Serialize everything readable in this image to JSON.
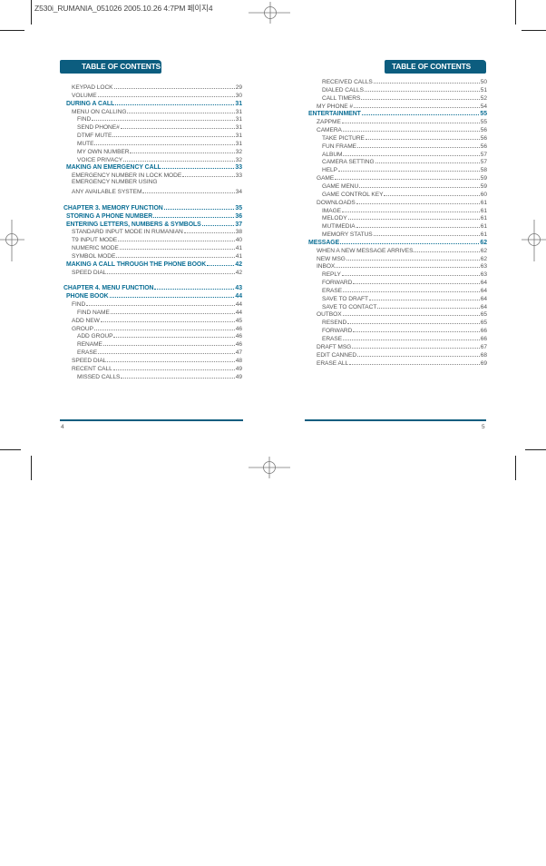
{
  "slug": "Z530i_RUMANIA_051026  2005.10.26 4:7PM 페이지4",
  "header_title": "TABLE OF CONTENTS",
  "left_page": {
    "folio": "4",
    "entries": [
      {
        "text": "KEYPAD LOCK",
        "page": "29",
        "style": "sub",
        "indent": 2
      },
      {
        "text": "VOLUME",
        "page": "30",
        "style": "sub",
        "indent": 2
      },
      {
        "text": "DURING A CALL",
        "page": "31",
        "style": "section",
        "indent": 1
      },
      {
        "text": "MENU ON CALLING",
        "page": "31",
        "style": "sub",
        "indent": 2
      },
      {
        "text": "FIND",
        "page": "31",
        "style": "sub",
        "indent": 3
      },
      {
        "text": "SEND PHONE#",
        "page": "31",
        "style": "sub",
        "indent": 3
      },
      {
        "text": "DTMF MUTE",
        "page": "31",
        "style": "sub",
        "indent": 3
      },
      {
        "text": "MUTE",
        "page": "31",
        "style": "sub",
        "indent": 3
      },
      {
        "text": "MY OWN NUMBER",
        "page": "32",
        "style": "sub",
        "indent": 3
      },
      {
        "text": "VOICE PRIVACY",
        "page": "32",
        "style": "sub",
        "indent": 3
      },
      {
        "text": "MAKING AN EMERGENCY CALL",
        "page": "33",
        "style": "section",
        "indent": 1
      },
      {
        "text": "EMERGENCY NUMBER IN LOCK MODE",
        "page": "33",
        "style": "sub",
        "indent": 2
      },
      {
        "text": "EMERGENCY NUMBER USING",
        "page": "",
        "style": "sub",
        "indent": 2
      },
      {
        "text": "ANY AVAILABLE SYSTEM",
        "page": "34",
        "style": "sub",
        "indent": 2
      },
      {
        "text": "",
        "page": "",
        "style": "gap",
        "indent": 0
      },
      {
        "text": "CHAPTER 3. MEMORY FUNCTION",
        "page": "35",
        "style": "chapter",
        "indent": 0
      },
      {
        "text": "STORING A PHONE NUMBER",
        "page": "36",
        "style": "section",
        "indent": 1
      },
      {
        "text": "ENTERING LETTERS, NUMBERS & SYMBOLS",
        "page": "37",
        "style": "section",
        "indent": 1
      },
      {
        "text": "STANDARD INPUT MODE IN RUMANIAN",
        "page": "38",
        "style": "sub",
        "indent": 2
      },
      {
        "text": "T9 INPUT MODE",
        "page": "40",
        "style": "sub",
        "indent": 2
      },
      {
        "text": "NUMERIC MODE",
        "page": "41",
        "style": "sub",
        "indent": 2
      },
      {
        "text": "SYMBOL MODE",
        "page": "41",
        "style": "sub",
        "indent": 2
      },
      {
        "text": "MAKING A CALL THROUGH THE PHONE BOOK",
        "page": "42",
        "style": "section",
        "indent": 1
      },
      {
        "text": "SPEED DIAL",
        "page": "42",
        "style": "sub",
        "indent": 2
      },
      {
        "text": "",
        "page": "",
        "style": "gap",
        "indent": 0
      },
      {
        "text": "CHAPTER 4. MENU FUNCTION",
        "page": "43",
        "style": "chapter",
        "indent": 0
      },
      {
        "text": "PHONE BOOK",
        "page": "44",
        "style": "section",
        "indent": 1
      },
      {
        "text": "FIND",
        "page": "44",
        "style": "sub",
        "indent": 2
      },
      {
        "text": "FIND NAME",
        "page": "44",
        "style": "sub",
        "indent": 3
      },
      {
        "text": "ADD NEW",
        "page": "45",
        "style": "sub",
        "indent": 2
      },
      {
        "text": "GROUP",
        "page": "46",
        "style": "sub",
        "indent": 2
      },
      {
        "text": "ADD GROUP",
        "page": "46",
        "style": "sub",
        "indent": 3
      },
      {
        "text": "RENAME",
        "page": "46",
        "style": "sub",
        "indent": 3
      },
      {
        "text": "ERASE",
        "page": "47",
        "style": "sub",
        "indent": 3
      },
      {
        "text": "SPEED DIAL",
        "page": "48",
        "style": "sub",
        "indent": 2
      },
      {
        "text": "RECENT CALL",
        "page": "49",
        "style": "sub",
        "indent": 2
      },
      {
        "text": "MISSED CALLS",
        "page": "49",
        "style": "sub",
        "indent": 3
      }
    ]
  },
  "right_page": {
    "folio": "5",
    "entries": [
      {
        "text": "RECEIVED CALLS",
        "page": "50",
        "style": "sub",
        "indent": 3
      },
      {
        "text": "DIALED CALLS",
        "page": "51",
        "style": "sub",
        "indent": 3
      },
      {
        "text": "CALL TIMERS",
        "page": "52",
        "style": "sub",
        "indent": 3
      },
      {
        "text": "MY PHONE #",
        "page": "54",
        "style": "sub",
        "indent": 2
      },
      {
        "text": "ENTERTAINMENT",
        "page": "55",
        "style": "section",
        "indent": 0
      },
      {
        "text": "ZAPPME",
        "page": "55",
        "style": "sub",
        "indent": 2
      },
      {
        "text": "CAMERA",
        "page": "56",
        "style": "sub",
        "indent": 2
      },
      {
        "text": "TAKE PICTURE",
        "page": "56",
        "style": "sub",
        "indent": 3
      },
      {
        "text": "FUN FRAME",
        "page": "56",
        "style": "sub",
        "indent": 3
      },
      {
        "text": "ALBUM",
        "page": "57",
        "style": "sub",
        "indent": 3
      },
      {
        "text": "CAMERA SETTING",
        "page": "57",
        "style": "sub",
        "indent": 3
      },
      {
        "text": "HELP",
        "page": "58",
        "style": "sub",
        "indent": 3
      },
      {
        "text": "GAME",
        "page": "59",
        "style": "sub",
        "indent": 2
      },
      {
        "text": "GAME MENU",
        "page": "59",
        "style": "sub",
        "indent": 3
      },
      {
        "text": "GAME CONTROL KEY",
        "page": "60",
        "style": "sub",
        "indent": 3
      },
      {
        "text": "DOWNLOADS",
        "page": "61",
        "style": "sub",
        "indent": 2
      },
      {
        "text": "IMAGE",
        "page": "61",
        "style": "sub",
        "indent": 3
      },
      {
        "text": "MELODY",
        "page": "61",
        "style": "sub",
        "indent": 3
      },
      {
        "text": "MUTIMEDIA",
        "page": "61",
        "style": "sub",
        "indent": 3
      },
      {
        "text": "MEMORY STATUS",
        "page": "61",
        "style": "sub",
        "indent": 3
      },
      {
        "text": "MESSAGE",
        "page": "62",
        "style": "section",
        "indent": 0
      },
      {
        "text": "WHEN A NEW MESSAGE ARRIVES",
        "page": "62",
        "style": "sub",
        "indent": 2
      },
      {
        "text": "NEW MSG",
        "page": "62",
        "style": "sub",
        "indent": 2
      },
      {
        "text": "INBOX",
        "page": "63",
        "style": "sub",
        "indent": 2
      },
      {
        "text": "REPLY",
        "page": "63",
        "style": "sub",
        "indent": 3
      },
      {
        "text": "FORWARD",
        "page": "64",
        "style": "sub",
        "indent": 3
      },
      {
        "text": "ERASE",
        "page": "64",
        "style": "sub",
        "indent": 3
      },
      {
        "text": "SAVE TO DRAFT",
        "page": "64",
        "style": "sub",
        "indent": 3
      },
      {
        "text": "SAVE TO CONTACT",
        "page": "64",
        "style": "sub",
        "indent": 3
      },
      {
        "text": "OUTBOX",
        "page": "65",
        "style": "sub",
        "indent": 2
      },
      {
        "text": "RESEND",
        "page": "65",
        "style": "sub",
        "indent": 3
      },
      {
        "text": "FORWARD",
        "page": "66",
        "style": "sub",
        "indent": 3
      },
      {
        "text": "ERASE",
        "page": "66",
        "style": "sub",
        "indent": 3
      },
      {
        "text": "DRAFT MSG",
        "page": "67",
        "style": "sub",
        "indent": 2
      },
      {
        "text": "EDIT CANNED",
        "page": "68",
        "style": "sub",
        "indent": 2
      },
      {
        "text": "ERASE ALL",
        "page": "69",
        "style": "sub",
        "indent": 2
      }
    ]
  },
  "colors": {
    "accent": "#0c5d7f",
    "heading_text": "#0c6f95",
    "body_text": "#555555"
  },
  "icons": {
    "registration_mark": "registration-target-icon",
    "crop_mark": "crop-mark-icon"
  }
}
